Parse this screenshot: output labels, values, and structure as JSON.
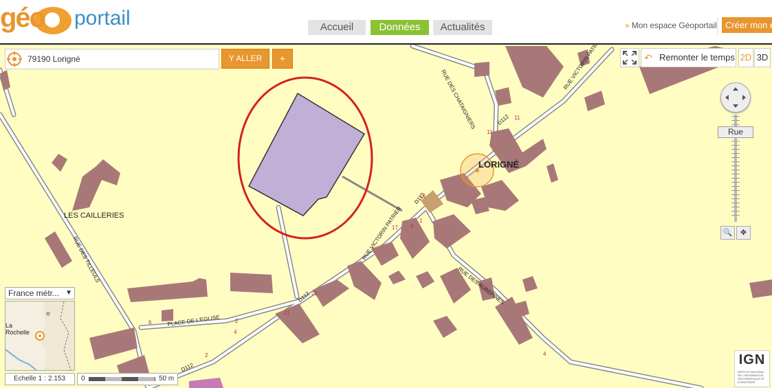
{
  "header": {
    "logo_geo": "géo",
    "logo_portal": "portail",
    "nav": [
      "Accueil",
      "Données",
      "Actualités"
    ],
    "espace_label": "Mon espace Géoportail",
    "creer_label": "Créer mon e"
  },
  "search": {
    "value": "79190 Lorigné",
    "go_label": "Y ALLER",
    "plus_label": "+"
  },
  "toolbar": {
    "remonter_label": "Remonter le temps",
    "dim_2d": "2D",
    "dim_3d": "3D"
  },
  "zoom": {
    "level_label": "Rue"
  },
  "overview": {
    "territory_label": "France métr...",
    "city_label": "La Rochelle"
  },
  "scale": {
    "label": "Echelle 1 :",
    "value": "2.153",
    "bar_start": "0",
    "bar_end": "50 m"
  },
  "attribution": {
    "logo": "IGN",
    "subtitle": "INSTITUT NATIONAL DE L'INFORMATION GÉOGRAPHIQUE ET FORESTIÈRE"
  },
  "map_labels": {
    "place_lorigne": "LORIGNÉ",
    "place_cailleries": "LES CAILLERIES",
    "rue_chataigniers": "RUE DES CHATAIGNIERS",
    "rue_victorin_top": "RUE VICTORIN PATRIER",
    "rue_victorin_mid": "RUE VICTORIN PATRIER",
    "rue_tilleuls": "RUE DES TILLEULS",
    "rue_aubepines": "RUE DES AUBEPINES",
    "place_eglise": "PLACE DE L'EGLISE",
    "d112_a": "D112",
    "d112_b": "D112",
    "d112_c": "D112",
    "d112_d": "D112"
  },
  "house_numbers": [
    "11",
    "11",
    "15",
    "1",
    "17",
    "9",
    "25",
    "21",
    "6",
    "2",
    "4",
    "2",
    "4"
  ],
  "colors": {
    "map_background": "#fffdc2",
    "building": "#a87878",
    "parcel_fill": "#c0b0d8",
    "highlight_circle": "#d42020",
    "accent_orange": "#e8962e",
    "accent_green": "#8ac234"
  }
}
